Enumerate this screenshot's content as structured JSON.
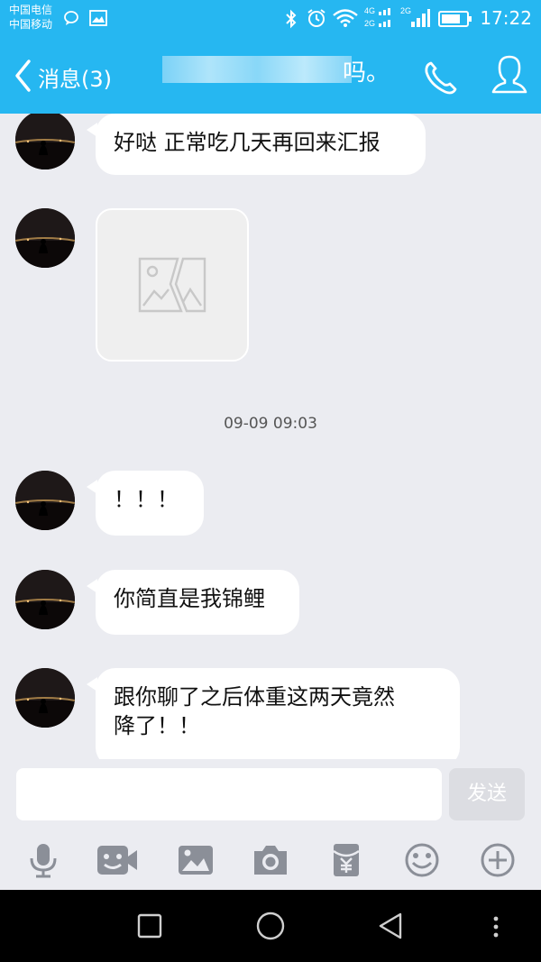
{
  "status_bar": {
    "carrier_1": "中国电信",
    "carrier_2": "中国移动",
    "network_1": "4G",
    "network_2": "2G",
    "network_3": "2G",
    "time": "17:22",
    "icons": [
      "message-icon",
      "image-notification-icon",
      "bluetooth-icon",
      "alarm-icon",
      "wifi-icon",
      "signal-4g-icon",
      "signal-2g-icon",
      "battery-icon"
    ]
  },
  "header": {
    "back_label": "消息(3)",
    "title_suffix": "吗。",
    "call_icon": "phone-icon",
    "profile_icon": "user-icon"
  },
  "messages": [
    {
      "type": "text",
      "text": "好哒 正常吃几天再回来汇报"
    },
    {
      "type": "image",
      "icon": "image-placeholder-icon"
    },
    {
      "type": "timestamp",
      "text": "09-09 09:03"
    },
    {
      "type": "text",
      "text": "！！！"
    },
    {
      "type": "text",
      "text": "你简直是我锦鲤"
    },
    {
      "type": "text",
      "lines": [
        "跟你聊了之后体重这两天竟然",
        "降了！！"
      ]
    }
  ],
  "input": {
    "placeholder": "",
    "send_label": "发送"
  },
  "toolbar": [
    "microphone-icon",
    "video-icon",
    "picture-icon",
    "camera-icon",
    "red-packet-icon",
    "emoji-icon",
    "plus-icon"
  ],
  "system_nav": [
    "square-icon",
    "circle-icon",
    "triangle-icon",
    "more-icon"
  ],
  "colors": {
    "header": "#26b7f1",
    "background": "#ebecf1",
    "bubble": "#ffffff"
  }
}
